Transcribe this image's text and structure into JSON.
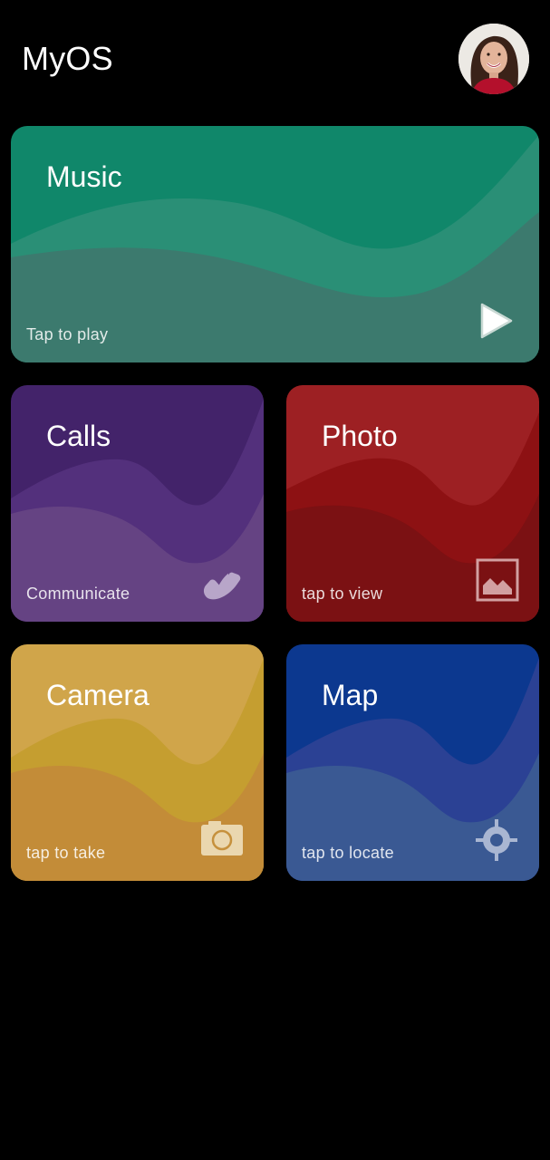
{
  "header": {
    "title": "MyOS"
  },
  "cards": {
    "music": {
      "title": "Music",
      "subtitle": "Tap to play",
      "icon": "play-icon",
      "colors": {
        "top": "#10876a",
        "mid": "#2a8f76",
        "bottom": "#3c7a6e"
      }
    },
    "calls": {
      "title": "Calls",
      "subtitle": "Communicate",
      "icon": "phone-icon",
      "colors": {
        "top": "#43236a",
        "mid": "#53307c",
        "bottom": "#654383"
      }
    },
    "photo": {
      "title": "Photo",
      "subtitle": "tap to view",
      "icon": "image-icon",
      "colors": {
        "top": "#9d2023",
        "mid": "#8d1113",
        "bottom": "#7b1113"
      }
    },
    "camera": {
      "title": "Camera",
      "subtitle": "tap to take",
      "icon": "camera-icon",
      "colors": {
        "top": "#d0a54a",
        "mid": "#c59e30",
        "bottom": "#c38c38"
      }
    },
    "map": {
      "title": "Map",
      "subtitle": "tap to locate",
      "icon": "crosshair-icon",
      "colors": {
        "top": "#0c388f",
        "mid": "#2b4194",
        "bottom": "#3a5993"
      }
    }
  }
}
